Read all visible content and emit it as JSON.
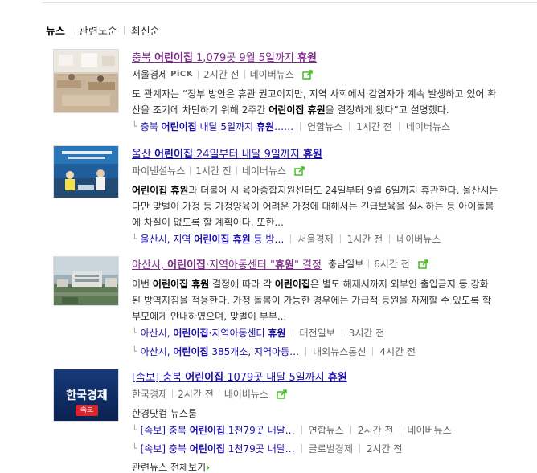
{
  "sort": {
    "news": "뉴스",
    "relevance": "관련도순",
    "latest": "최신순"
  },
  "items": [
    {
      "title_pre": "충북 ",
      "title_hl": "어린이집",
      "title_post": " 1,079곳 9월 5일까지 ",
      "title_hl2": "휴원",
      "press": "서울경제",
      "pick": "PiCK",
      "time": "2시간 전",
      "platform": "네이버뉴스",
      "desc_line1": "도 관계자는 “정부 방안은 휴관 권고이지만, 지역 사회에서 감염자가 계속 발생하고 있어 확",
      "desc_line2_pre": "산을 조기에 차단하기 위해 2주간 ",
      "desc_line2_hl": "어린이집 휴원",
      "desc_line2_post": "을 결정하게 됐다”고 설명했다.",
      "related": [
        {
          "pre": "충북 ",
          "hl": "어린이집",
          "mid": " 내달 5일까지 ",
          "hl2": "휴원",
          "post": "……",
          "press": "연합뉴스",
          "time": "1시간 전",
          "platform": "네이버뉴스"
        }
      ]
    },
    {
      "title_pre": "울산 ",
      "title_hl": "어린이집",
      "title_post": " 24일부터 내달 9일까지 ",
      "title_hl2": "휴원",
      "press": "파이낸셜뉴스",
      "time": "1시간 전",
      "platform": "네이버뉴스",
      "desc_line1_hl": "어린이집 휴원",
      "desc_line1_post": "과 더불어 시 육아종합지원센터도 24일부터 9월 6일까지 휴관한다. 울산시는",
      "desc_line2": "다만 맞벌이 가정 등 가정양육이 어려운 가정에 대해서는 긴급보육을 실시하는 등 아이돌봄",
      "desc_line3": "에 차질이 없도록 할 계획이다. 또한...",
      "related": [
        {
          "pre": "울산시, 지역 ",
          "hl": "어린이집 휴원",
          "post": " 등 방…",
          "press": "서울경제",
          "time": "1시간 전",
          "platform": "네이버뉴스"
        }
      ]
    },
    {
      "title_pre": "아산시, ",
      "title_hl": "어린이집",
      "title_post": "·지역아동센터 \"",
      "title_hl2": "휴원",
      "title_post2": "\" 결정",
      "press": "충남일보",
      "time": "6시간 전",
      "desc_line1_pre": "이번 ",
      "desc_line1_hl": "어린이집 휴원",
      "desc_line1_mid": " 결정에 따라 각 ",
      "desc_line1_hl2": "어린이집",
      "desc_line1_post": "은 별도 해제시까지 외부인 출입금지 등 강화",
      "desc_line2": "된 방역지침을 적용한다. 가정 돌봄이 가능한 경우에는 가급적 등원을 자제할 수 있도록 학",
      "desc_line3": "부모에게 안내하였으며, 맞벌이 부부...",
      "related": [
        {
          "pre": "아산시, ",
          "hl": "어린이집",
          "mid": "·지역아동센터 ",
          "hl2": "휴원",
          "post": "",
          "press": "대전일보",
          "time": "3시간 전"
        },
        {
          "pre": "아산시, ",
          "hl": "어린이집",
          "mid": " 385개소, 지역아동…",
          "press": "내외뉴스통신",
          "time": "4시간 전"
        }
      ]
    },
    {
      "title_pre": "[속보] 충북 ",
      "title_hl": "어린이집",
      "title_post": " 1079곳 내달 5일까지 ",
      "title_hl2": "휴원",
      "thumb_text": "한국경제",
      "thumb_badge": "속보",
      "press": "한국경제",
      "time": "2시간 전",
      "platform": "네이버뉴스",
      "desc_line1": "한경닷컴 뉴스룸",
      "related": [
        {
          "pre": "[속보] 충북 ",
          "hl": "어린이집",
          "mid": " 1천79곳 내달…",
          "press": "연합뉴스",
          "time": "2시간 전",
          "platform": "네이버뉴스"
        },
        {
          "pre": "[속보] 충북 ",
          "hl": "어린이집",
          "mid": " 1천79곳 내달…",
          "press": "글로벌경제",
          "time": "2시간 전"
        }
      ],
      "more": "관련뉴스 전체보기"
    }
  ],
  "colors": {
    "link": "#1a0dab",
    "visited": "#7b2a88",
    "share": "#2db400"
  }
}
